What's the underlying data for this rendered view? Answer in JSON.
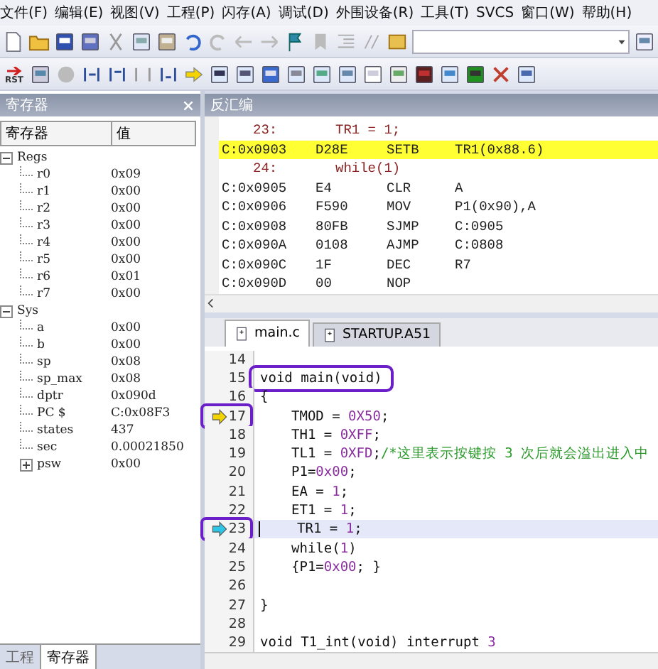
{
  "menu": [
    "文件(F)",
    "编辑(E)",
    "视图(V)",
    "工程(P)",
    "闪存(A)",
    "调试(D)",
    "外围设备(R)",
    "工具(T)",
    "SVCS",
    "窗口(W)",
    "帮助(H)"
  ],
  "toolbar": {
    "reset_label": "RST"
  },
  "registers": {
    "title": "寄存器",
    "columns": [
      "寄存器",
      "值"
    ],
    "tree": [
      {
        "name": "Regs",
        "expanded": true,
        "children": [
          {
            "name": "r0",
            "value": "0x09"
          },
          {
            "name": "r1",
            "value": "0x00"
          },
          {
            "name": "r2",
            "value": "0x00"
          },
          {
            "name": "r3",
            "value": "0x00"
          },
          {
            "name": "r4",
            "value": "0x00"
          },
          {
            "name": "r5",
            "value": "0x00"
          },
          {
            "name": "r6",
            "value": "0x01"
          },
          {
            "name": "r7",
            "value": "0x00"
          }
        ]
      },
      {
        "name": "Sys",
        "expanded": true,
        "children": [
          {
            "name": "a",
            "value": "0x00"
          },
          {
            "name": "b",
            "value": "0x00"
          },
          {
            "name": "sp",
            "value": "0x08"
          },
          {
            "name": "sp_max",
            "value": "0x08"
          },
          {
            "name": "dptr",
            "value": "0x090d"
          },
          {
            "name": "PC  $",
            "value": "C:0x08F3"
          },
          {
            "name": "states",
            "value": "437"
          },
          {
            "name": "sec",
            "value": "0.00021850"
          },
          {
            "name": "psw",
            "value": "0x00",
            "expanded": false
          }
        ]
      }
    ],
    "bottom_tabs": [
      {
        "label": "工程",
        "selected": false
      },
      {
        "label": "寄存器",
        "selected": true
      }
    ]
  },
  "disassembly": {
    "title": "反汇编",
    "rows": [
      {
        "kind": "source",
        "line": "23:",
        "code": "TR1 = 1;"
      },
      {
        "kind": "instr",
        "address": "C:0x0903",
        "opcode": "D28E",
        "mnemonic": "SETB",
        "operand": "TR1(0x88.6)",
        "current": true
      },
      {
        "kind": "source",
        "line": "24:",
        "code": "while(1)"
      },
      {
        "kind": "instr",
        "address": "C:0x0905",
        "opcode": "E4",
        "mnemonic": "CLR",
        "operand": "A",
        "current": false
      },
      {
        "kind": "instr",
        "address": "C:0x0906",
        "opcode": "F590",
        "mnemonic": "MOV",
        "operand": "P1(0x90),A",
        "current": false
      },
      {
        "kind": "instr",
        "address": "C:0x0908",
        "opcode": "80FB",
        "mnemonic": "SJMP",
        "operand": "C:0905",
        "current": false
      },
      {
        "kind": "instr",
        "address": "C:0x090A",
        "opcode": "0108",
        "mnemonic": "AJMP",
        "operand": "C:0808",
        "current": false
      },
      {
        "kind": "instr",
        "address": "C:0x090C",
        "opcode": "1F",
        "mnemonic": "DEC",
        "operand": "R7",
        "current": false
      },
      {
        "kind": "instr",
        "address": "C:0x090D",
        "opcode": "00",
        "mnemonic": "NOP",
        "current": false
      }
    ]
  },
  "editor": {
    "tabs": [
      {
        "label": "main.c",
        "selected": true
      },
      {
        "label": "STARTUP.A51",
        "selected": false
      }
    ],
    "lines": [
      {
        "number": "14"
      },
      {
        "number": "15",
        "indent": false,
        "circled_code": true,
        "tokens": [
          {
            "kind": "plain",
            "text": "void main(void)"
          }
        ]
      },
      {
        "number": "16",
        "indent": false,
        "tokens": [
          {
            "kind": "plain",
            "text": "{"
          }
        ]
      },
      {
        "number": "17",
        "indent": true,
        "pc_arrow": true,
        "circled_number": true,
        "tokens": [
          {
            "kind": "plain",
            "text": "TMOD = "
          },
          {
            "kind": "number",
            "text": "0X50"
          },
          {
            "kind": "plain",
            "text": ";"
          }
        ]
      },
      {
        "number": "18",
        "indent": true,
        "tokens": [
          {
            "kind": "plain",
            "text": "TH1 = "
          },
          {
            "kind": "number",
            "text": "0XFF"
          },
          {
            "kind": "plain",
            "text": ";"
          }
        ]
      },
      {
        "number": "19",
        "indent": true,
        "tokens": [
          {
            "kind": "plain",
            "text": "TL1 = "
          },
          {
            "kind": "number",
            "text": "0XFD"
          },
          {
            "kind": "plain",
            "text": ";"
          },
          {
            "kind": "comment",
            "text": "/*这里表示按键按 3 次后就会溢出进入中"
          }
        ]
      },
      {
        "number": "20",
        "indent": true,
        "tokens": [
          {
            "kind": "plain",
            "text": "P1="
          },
          {
            "kind": "number",
            "text": "0x00"
          },
          {
            "kind": "plain",
            "text": ";"
          }
        ]
      },
      {
        "number": "21",
        "indent": true,
        "tokens": [
          {
            "kind": "plain",
            "text": "EA = "
          },
          {
            "kind": "number",
            "text": "1"
          },
          {
            "kind": "plain",
            "text": ";"
          }
        ]
      },
      {
        "number": "22",
        "indent": true,
        "tokens": [
          {
            "kind": "plain",
            "text": "ET1 = "
          },
          {
            "kind": "number",
            "text": "1"
          },
          {
            "kind": "plain",
            "text": ";"
          }
        ]
      },
      {
        "number": "23",
        "indent": true,
        "cursor_arrow": true,
        "circled_number": true,
        "highlighted": true,
        "tokens": [
          {
            "kind": "plain",
            "text": "TR1 = "
          },
          {
            "kind": "number",
            "text": "1"
          },
          {
            "kind": "plain",
            "text": ";"
          }
        ]
      },
      {
        "number": "24",
        "indent": true,
        "tokens": [
          {
            "kind": "plain",
            "text": "while("
          },
          {
            "kind": "number",
            "text": "1"
          },
          {
            "kind": "plain",
            "text": ")"
          }
        ]
      },
      {
        "number": "25",
        "indent": true,
        "tokens": [
          {
            "kind": "plain",
            "text": "{P1="
          },
          {
            "kind": "number",
            "text": "0x00"
          },
          {
            "kind": "plain",
            "text": ";   }"
          }
        ]
      },
      {
        "number": "26"
      },
      {
        "number": "27",
        "indent": false,
        "tokens": [
          {
            "kind": "plain",
            "text": "}"
          }
        ]
      },
      {
        "number": "28"
      },
      {
        "number": "29",
        "indent": false,
        "tokens": [
          {
            "kind": "plain",
            "text": "void T1_int(void) interrupt "
          },
          {
            "kind": "number",
            "text": "3"
          }
        ]
      }
    ]
  }
}
